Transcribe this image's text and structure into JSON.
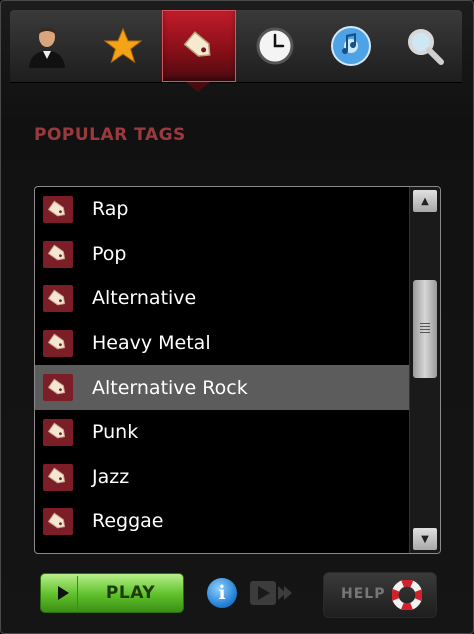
{
  "tabs": [
    {
      "id": "profile",
      "icon": "user-icon"
    },
    {
      "id": "favorites",
      "icon": "star-icon"
    },
    {
      "id": "tags",
      "icon": "tag-icon",
      "active": true
    },
    {
      "id": "history",
      "icon": "clock-icon"
    },
    {
      "id": "music",
      "icon": "music-disc-icon"
    },
    {
      "id": "search",
      "icon": "search-icon"
    }
  ],
  "section": {
    "title": "POPULAR TAGS"
  },
  "tag_list": {
    "items": [
      "Rap",
      "Pop",
      "Alternative",
      "Heavy Metal",
      "Alternative Rock",
      "Punk",
      "Jazz",
      "Reggae"
    ],
    "selected_index": 4
  },
  "controls": {
    "play_label": "PLAY",
    "help_label": "HELP"
  },
  "colors": {
    "accent": "#8a0f18",
    "title": "#9b3a3e",
    "play_green": "#5fbf2a",
    "selected_row": "#5c5c5c"
  }
}
